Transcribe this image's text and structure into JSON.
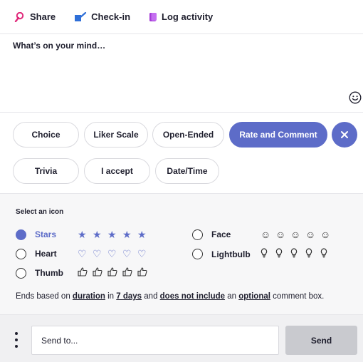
{
  "tabs": [
    {
      "label": "Share",
      "icon": "megaphone-icon",
      "color": "#e0287a"
    },
    {
      "label": "Check-in",
      "icon": "flag-icon",
      "color": "#2f6fd8"
    },
    {
      "label": "Log activity",
      "icon": "log-icon",
      "color": "#a43bd6"
    }
  ],
  "compose": {
    "placeholder": "What’s on your mind…",
    "emoji_icon": "smiley-icon"
  },
  "poll_types": [
    {
      "label": "Choice",
      "active": false
    },
    {
      "label": "Liker Scale",
      "active": false
    },
    {
      "label": "Open-Ended",
      "active": false
    },
    {
      "label": "Rate and Comment",
      "active": true
    },
    {
      "label": "Trivia",
      "active": false
    },
    {
      "label": "I accept",
      "active": false
    },
    {
      "label": "Date/Time",
      "active": false
    }
  ],
  "icon_select": {
    "label": "Select an icon",
    "options": [
      {
        "label": "Stars",
        "selected": true,
        "glyph": "★",
        "count": 5,
        "color": "#5d6cc8"
      },
      {
        "label": "Face",
        "selected": false,
        "glyph": "☺",
        "count": 5,
        "color": "#333333"
      },
      {
        "label": "Heart",
        "selected": false,
        "glyph": "♡",
        "count": 5,
        "color": "#5d6cc8"
      },
      {
        "label": "Lightbulb",
        "selected": false,
        "glyph": "lightbulb-icon",
        "count": 5,
        "color": "#333333"
      },
      {
        "label": "Thumb",
        "selected": false,
        "glyph": "thumbs-up-icon",
        "count": 5,
        "color": "#333333"
      }
    ]
  },
  "ends": {
    "prefix": "Ends based on ",
    "duration": "duration",
    "in": " in ",
    "days": "7 days",
    "and": " and ",
    "include": "does not include",
    "an": " an ",
    "optional": "optional",
    "suffix": " comment box."
  },
  "sendbar": {
    "placeholder": "Send to...",
    "send_label": "Send"
  },
  "accent_color": "#5d6cc8"
}
